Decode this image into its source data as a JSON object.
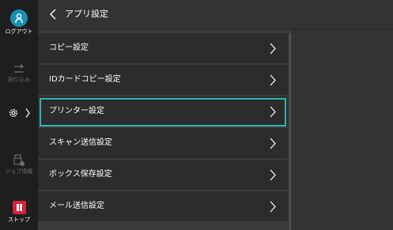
{
  "rail": {
    "logout_label": "ログアウト",
    "interrupt_label": "割り込み",
    "jobinfo_label": "ジョブ情報",
    "stop_label": "ストップ"
  },
  "header": {
    "title": "アプリ設定"
  },
  "menu": {
    "items": [
      {
        "label": "コピー設定"
      },
      {
        "label": "IDカードコピー設定"
      },
      {
        "label": "プリンター設定"
      },
      {
        "label": "スキャン送信設定"
      },
      {
        "label": "ボックス保存設定"
      },
      {
        "label": "メール送信設定"
      }
    ],
    "selected_index": 2
  },
  "colors": {
    "accent_selected": "#2ab7b0",
    "logout_circle": "#1a8fb0",
    "stop_button": "#d8223b"
  }
}
